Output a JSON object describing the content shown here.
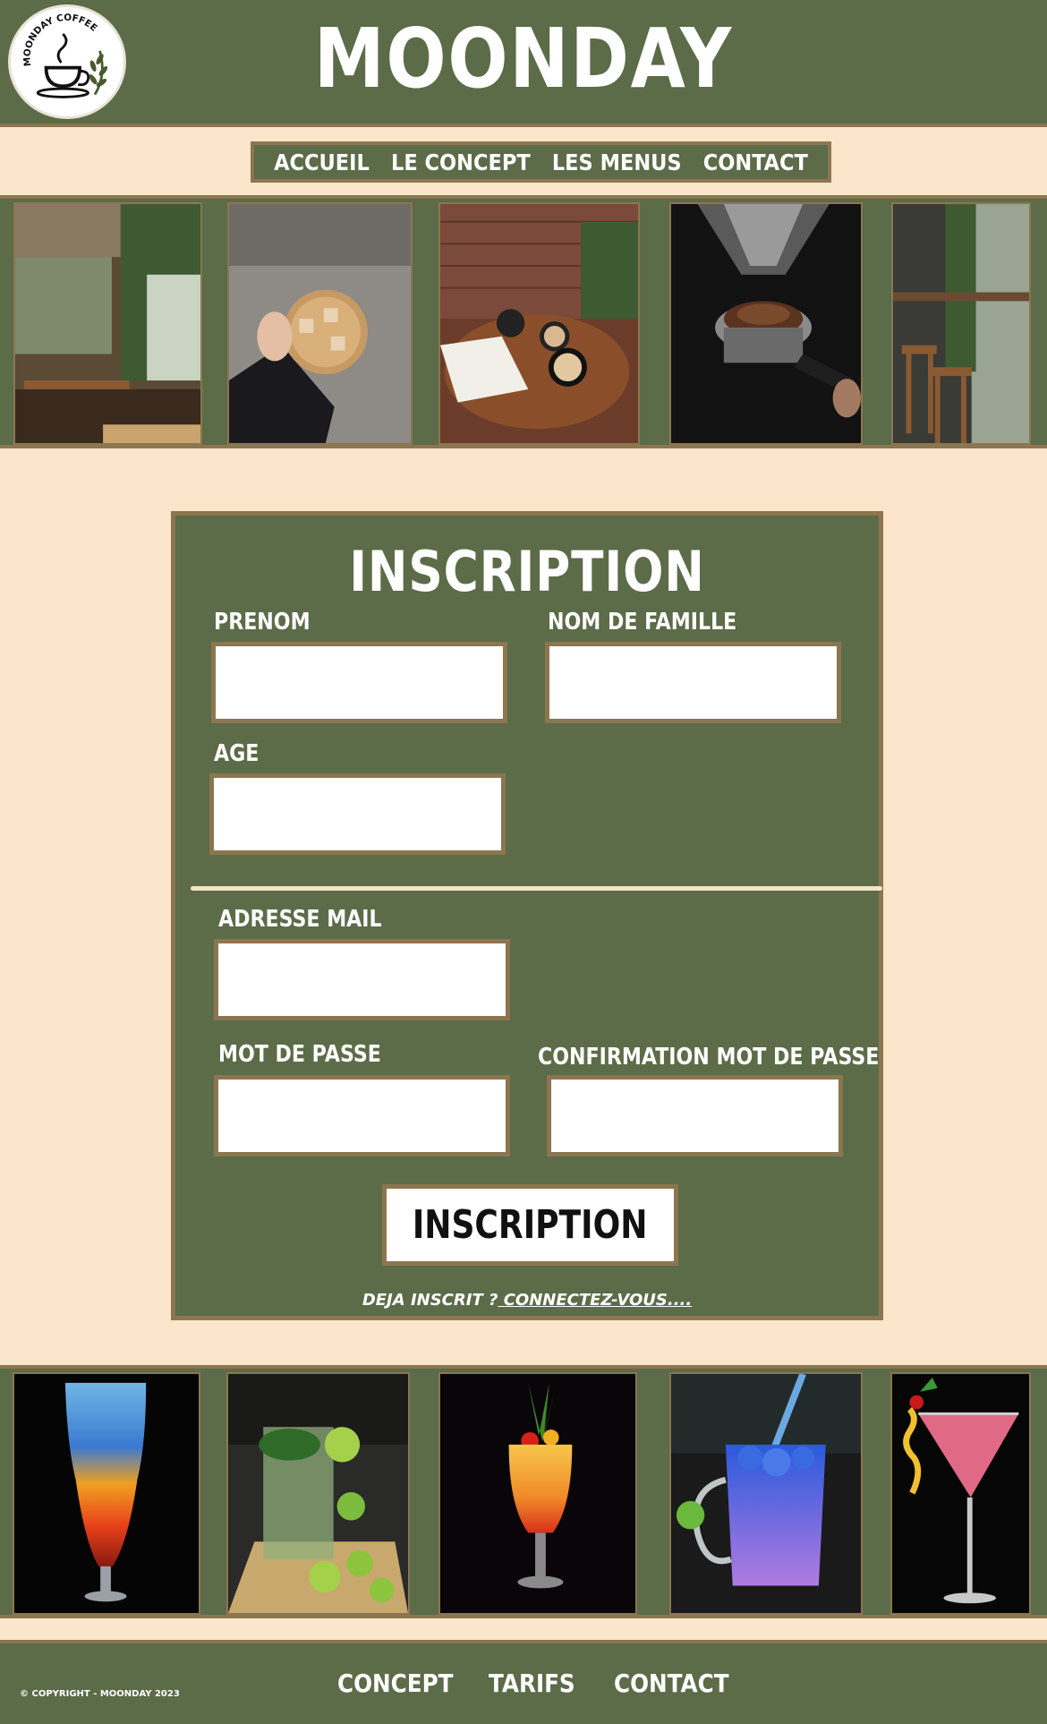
{
  "header": {
    "title": "MOONDAY",
    "logo_text": "MOONDAY COFFEE"
  },
  "nav": {
    "items": [
      {
        "label": "ACCUEIL"
      },
      {
        "label": "LE CONCEPT"
      },
      {
        "label": "LES MENUS"
      },
      {
        "label": "CONTACT"
      }
    ]
  },
  "gallery_top": {
    "photos": [
      "cafe-interior-photo",
      "iced-coffee-photo",
      "latte-table-photo",
      "espresso-grinder-photo",
      "window-bar-photo"
    ]
  },
  "form": {
    "title": "INSCRIPTION",
    "prenom_label": "PRENOM",
    "nom_label": "NOM DE FAMILLE",
    "age_label": "AGE",
    "email_label": "ADRESSE MAIL",
    "password_label": "MOT DE PASSE",
    "confirm_label": "CONFIRMATION MOT DE PASSE",
    "submit_label": "INSCRIPTION",
    "already_text": "DEJA INSCRIT ?",
    "login_link": " CONNECTEZ-VOUS...."
  },
  "gallery_bottom": {
    "photos": [
      "blue-lagoon-cocktail-photo",
      "mojito-photo",
      "tequila-sunrise-photo",
      "butterfly-pea-drink-photo",
      "cosmopolitan-photo"
    ]
  },
  "footer": {
    "copyright": "© COPYRIGHT - MOONDAY 2023",
    "links": [
      {
        "label": "CONCEPT"
      },
      {
        "label": "TARIFS"
      },
      {
        "label": "CONTACT"
      }
    ]
  },
  "colors": {
    "olive": "#5c6b48",
    "cream": "#fbe6cc",
    "brown_border": "#8b7650"
  }
}
